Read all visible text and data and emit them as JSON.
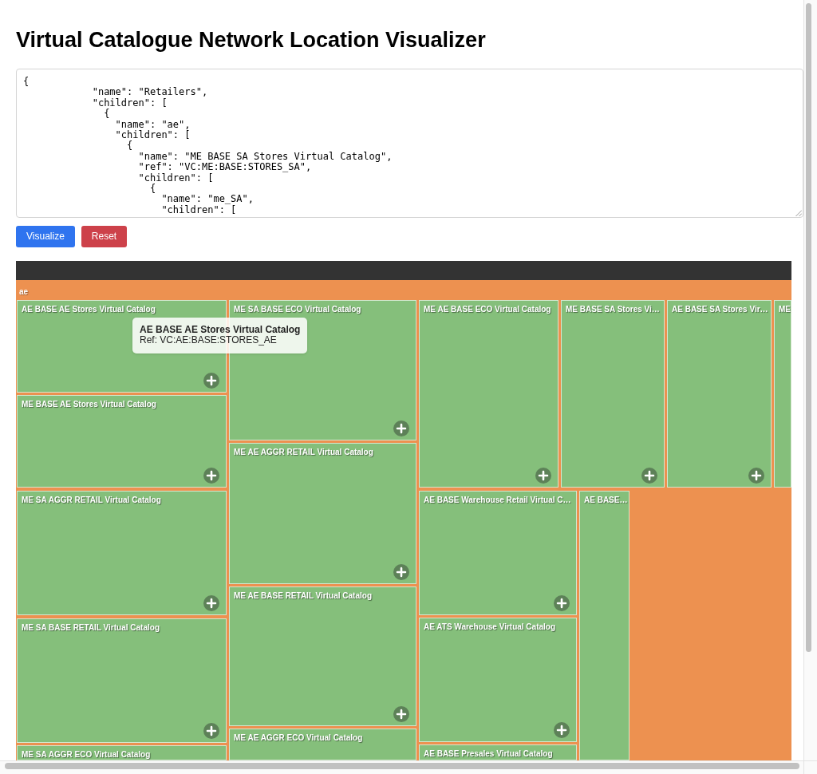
{
  "page": {
    "title": "Virtual Catalogue Network Location Visualizer"
  },
  "editor": {
    "value": "{\n            \"name\": \"Retailers\",\n            \"children\": [\n              {\n                \"name\": \"ae\",\n                \"children\": [\n                  {\n                    \"name\": \"ME BASE SA Stores Virtual Catalog\",\n                    \"ref\": \"VC:ME:BASE:STORES_SA\",\n                    \"children\": [\n                      {\n                        \"name\": \"me_SA\",\n                        \"children\": ["
  },
  "buttons": [
    {
      "label": "Visualize",
      "kind": "primary"
    },
    {
      "label": "Reset",
      "kind": "danger"
    }
  ],
  "treemap": {
    "group": {
      "name": "ae",
      "tiles": [
        {
          "name": "AE BASE AE Stores Virtual Catalog"
        },
        {
          "name": "ME BASE AE Stores Virtual Catalog"
        },
        {
          "name": "ME SA AGGR RETAIL Virtual Catalog"
        },
        {
          "name": "ME SA BASE RETAIL Virtual Catalog"
        },
        {
          "name": "ME SA AGGR ECO Virtual Catalog"
        },
        {
          "name": "ME SA BASE ECO Virtual Catalog"
        },
        {
          "name": "ME AE AGGR RETAIL Virtual Catalog"
        },
        {
          "name": "ME AE BASE RETAIL Virtual Catalog"
        },
        {
          "name": "ME AE AGGR ECO Virtual Catalog"
        },
        {
          "name": "ME AE BASE ECO Virtual Catalog"
        },
        {
          "name": "ME BASE SA Stores Vi…"
        },
        {
          "name": "AE BASE SA Stores Vir…"
        },
        {
          "name": "ME"
        },
        {
          "name": "AE BASE Warehouse Retail Virtual C…"
        },
        {
          "name": "AE ATS Warehouse Virtual Catalog"
        },
        {
          "name": "AE BASE Presales Virtual Catalog"
        },
        {
          "name": "AE BASE…"
        }
      ]
    },
    "tooltip": {
      "title": "AE BASE AE Stores Virtual Catalog",
      "ref": "Ref: VC:AE:BASE:STORES_AE"
    }
  }
}
